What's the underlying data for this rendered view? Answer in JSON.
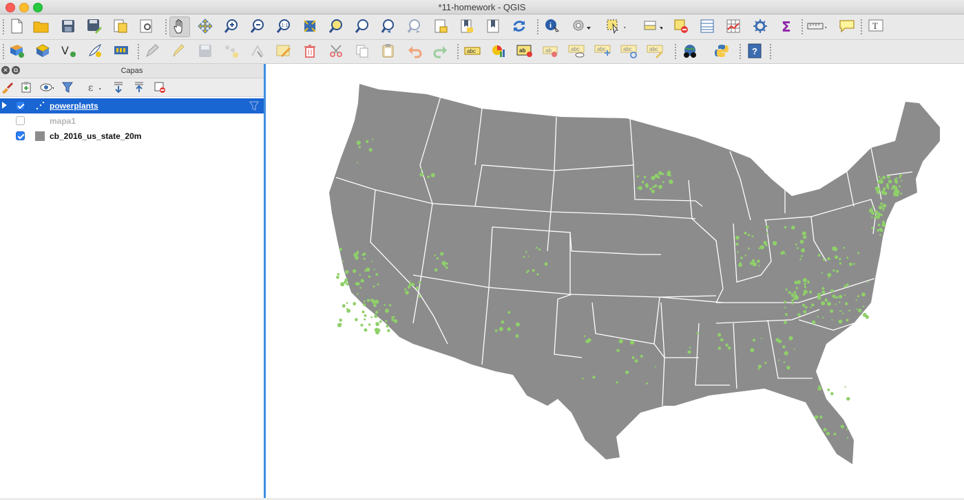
{
  "window": {
    "title": "*11-homework - QGIS"
  },
  "toolbar_row1": {
    "tools": [
      "new-project-icon",
      "open-project-icon",
      "save-project-icon",
      "save-as-icon",
      "new-print-layout-icon",
      "layout-manager-icon",
      "pan-icon",
      "pan-to-selection-icon",
      "zoom-in-icon",
      "zoom-out-icon",
      "zoom-native-icon",
      "zoom-full-icon",
      "zoom-to-selection-icon",
      "zoom-to-layer-icon",
      "zoom-last-icon",
      "zoom-next-icon",
      "new-map-view-icon",
      "new-bookmark-icon",
      "show-bookmarks-icon",
      "refresh-icon",
      "identify-icon",
      "measure-icon",
      "select-features-icon",
      "attribute-table-icon",
      "deselect-icon",
      "open-table-icon",
      "statistics-icon",
      "settings-icon",
      "sum-icon",
      "ruler-icon",
      "map-tips-icon",
      "text-annotation-icon"
    ]
  },
  "toolbar_row2": {
    "tools": [
      "data-source-manager-icon",
      "new-geopackage-icon",
      "digitize-vertex-icon",
      "add-feature-icon",
      "save-edits-icon",
      "pencil-icon",
      "save-layer-edits-icon",
      "add-point-icon",
      "node-tool-icon",
      "modify-attributes-icon",
      "delete-icon",
      "cut-icon",
      "copy-icon",
      "paste-icon",
      "undo-icon",
      "redo-icon",
      "label-icon",
      "diagram-icon",
      "label-pin-icon",
      "label-move-icon",
      "label-show-icon",
      "label-rotate-icon",
      "label-change-icon",
      "label-properties-icon",
      "globe-plugin-icon",
      "python-icon",
      "help-icon"
    ]
  },
  "layers_panel": {
    "title": "Capas",
    "tools": [
      "style-icon",
      "add-group-icon",
      "visibility-icon",
      "filter-icon",
      "expression-filter-icon",
      "expand-all-icon",
      "collapse-all-icon",
      "remove-layer-icon"
    ],
    "layers": [
      {
        "name": "powerplants",
        "checked": true,
        "selected": true,
        "visible": true,
        "type": "point"
      },
      {
        "name": "mapa1",
        "checked": false,
        "selected": false,
        "visible": false,
        "type": "raster"
      },
      {
        "name": "cb_2016_us_state_20m",
        "checked": true,
        "selected": false,
        "visible": true,
        "type": "polygon"
      }
    ]
  },
  "map": {
    "land_color": "#8c8c8c",
    "border_color": "#ffffff",
    "point_color": "#8fd06a"
  },
  "colors": {
    "selection": "#1965d2",
    "accent": "#3f8fe0"
  }
}
